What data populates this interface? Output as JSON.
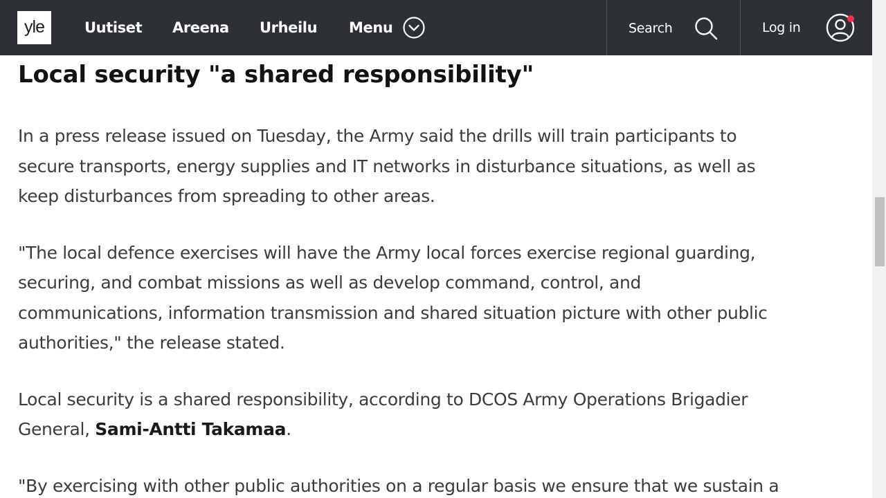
{
  "header": {
    "logo": "yle",
    "nav": [
      "Uutiset",
      "Areena",
      "Urheilu"
    ],
    "menu_label": "Menu",
    "search_label": "Search",
    "login_label": "Log in"
  },
  "article": {
    "heading": "Local security \"a shared responsibility\"",
    "p1_lines": [
      "In a press release issued on Tuesday, the Army said the drills will train participants to",
      "secure transports, energy supplies and IT networks in disturbance situations, as well as",
      "keep disturbances from spreading to other areas."
    ],
    "p2_lines": [
      "\"The local defence exercises will have the Army local forces exercise regional guarding,",
      "securing, and combat missions as well as develop command, control, and",
      "communications, information transmission and shared situation picture with other public",
      "authorities,\" the release stated."
    ],
    "p3": {
      "line1": "Local security is a shared responsibility, according to DCOS Army Operations Brigadier",
      "line2_prefix": "General, ",
      "person": "Sami-Antti Takamaa",
      "line2_suffix": "."
    },
    "p4_lines": [
      "\"By exercising with other public authorities on a regular basis we ensure that we sustain a"
    ]
  },
  "colors": {
    "header_bg": "#2d3135",
    "text": "#3c3c3c",
    "heading": "#121212",
    "notification": "#ff2e4a"
  }
}
